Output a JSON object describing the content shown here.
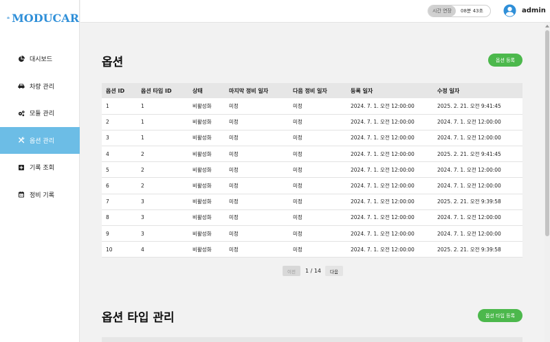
{
  "app": {
    "logo_text": "MODUCAR"
  },
  "header": {
    "extend_label": "시간 연장",
    "time_left": "08분 43초",
    "username": "admin"
  },
  "sidebar": {
    "items": [
      {
        "label": "대시보드",
        "icon": "pie-chart-icon"
      },
      {
        "label": "차량 관리",
        "icon": "car-icon"
      },
      {
        "label": "모듈 관리",
        "icon": "cogs-icon"
      },
      {
        "label": "옵션 관리",
        "icon": "tools-icon",
        "active": true
      },
      {
        "label": "기록 조회",
        "icon": "plus-square-icon"
      },
      {
        "label": "정비 기록",
        "icon": "calendar-icon"
      }
    ]
  },
  "options_section": {
    "title": "옵션",
    "register_label": "옵션 등록",
    "columns": [
      "옵션 ID",
      "옵션 타입 ID",
      "상태",
      "마지막 정비 일자",
      "다음 정비 일자",
      "등록 일자",
      "수정 일자"
    ],
    "rows": [
      [
        "1",
        "1",
        "비활성화",
        "미정",
        "미정",
        "2024. 7. 1. 오전 12:00:00",
        "2025. 2. 21. 오전 9:41:45"
      ],
      [
        "2",
        "1",
        "비활성화",
        "미정",
        "미정",
        "2024. 7. 1. 오전 12:00:00",
        "2024. 7. 1. 오전 12:00:00"
      ],
      [
        "3",
        "1",
        "비활성화",
        "미정",
        "미정",
        "2024. 7. 1. 오전 12:00:00",
        "2024. 7. 1. 오전 12:00:00"
      ],
      [
        "4",
        "2",
        "비활성화",
        "미정",
        "미정",
        "2024. 7. 1. 오전 12:00:00",
        "2025. 2. 21. 오전 9:41:45"
      ],
      [
        "5",
        "2",
        "비활성화",
        "미정",
        "미정",
        "2024. 7. 1. 오전 12:00:00",
        "2024. 7. 1. 오전 12:00:00"
      ],
      [
        "6",
        "2",
        "비활성화",
        "미정",
        "미정",
        "2024. 7. 1. 오전 12:00:00",
        "2024. 7. 1. 오전 12:00:00"
      ],
      [
        "7",
        "3",
        "비활성화",
        "미정",
        "미정",
        "2024. 7. 1. 오전 12:00:00",
        "2025. 2. 21. 오전 9:39:58"
      ],
      [
        "8",
        "3",
        "비활성화",
        "미정",
        "미정",
        "2024. 7. 1. 오전 12:00:00",
        "2024. 7. 1. 오전 12:00:00"
      ],
      [
        "9",
        "3",
        "비활성화",
        "미정",
        "미정",
        "2024. 7. 1. 오전 12:00:00",
        "2024. 7. 1. 오전 12:00:00"
      ],
      [
        "10",
        "4",
        "비활성화",
        "미정",
        "미정",
        "2024. 7. 1. 오전 12:00:00",
        "2025. 2. 21. 오전 9:39:58"
      ]
    ],
    "pagination": {
      "prev_label": "이전",
      "page_text": "1 / 14",
      "next_label": "다음"
    }
  },
  "option_types_section": {
    "title": "옵션 타입 관리",
    "register_label": "옵션 타입 등록"
  },
  "colors": {
    "brand": "#2f8fd8",
    "active_nav": "#6cbde6",
    "button_green": "#4cb84c"
  }
}
